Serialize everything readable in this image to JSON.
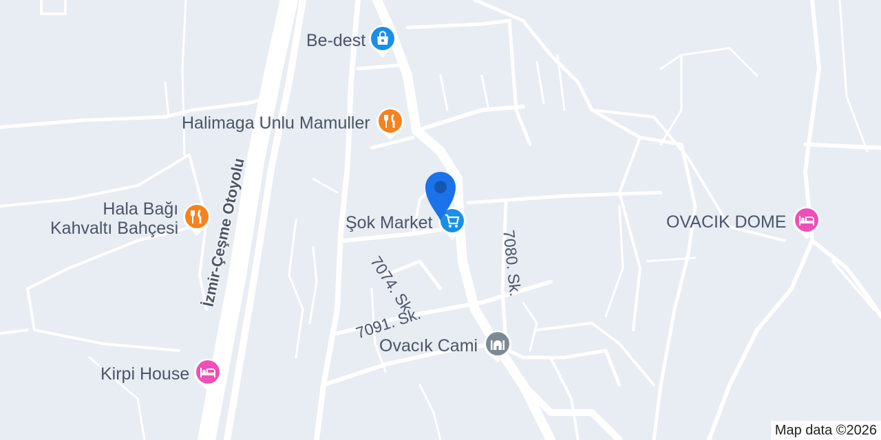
{
  "colors": {
    "background": "#e8ecf3",
    "road": "#ffffff",
    "label_text": "#4b5566",
    "shopping": "#1a8fe8",
    "food": "#f5821f",
    "lodging": "#ef4fb6",
    "worship": "#7d8a96",
    "location_marker": "#1a73e8"
  },
  "pois": [
    {
      "id": "be-dest",
      "label": "Be-dest",
      "category": "shopping",
      "icon": "shopping-bag-icon"
    },
    {
      "id": "halimaga",
      "label": "Halimaga Unlu Mamuller",
      "category": "food",
      "icon": "fork-knife-icon"
    },
    {
      "id": "hala-bagi",
      "label_lines": [
        "Hala Bağı",
        "Kahvaltı Bahçesi"
      ],
      "category": "food",
      "icon": "fork-knife-icon"
    },
    {
      "id": "sok-market",
      "label": "Şok Market",
      "category": "shopping",
      "icon": "shopping-cart-icon"
    },
    {
      "id": "ovacik-dome",
      "label": "OVACIK DOME",
      "category": "lodging",
      "icon": "bed-icon"
    },
    {
      "id": "ovacik-cami",
      "label": "Ovacık Cami",
      "category": "worship",
      "icon": "mosque-icon"
    },
    {
      "id": "kirpi-house",
      "label": "Kirpi House",
      "category": "lodging",
      "icon": "bed-icon"
    }
  ],
  "streets": [
    {
      "id": "otoyol",
      "label": "İzmir-Çeşme Otoyolu"
    },
    {
      "id": "s7074",
      "label": "7074. Sk."
    },
    {
      "id": "s7080",
      "label": "7080. Sk."
    },
    {
      "id": "s7091",
      "label": "7091. Sk."
    }
  ],
  "attribution": "Map data ©2026",
  "location_marker": {
    "icon": "location-pin-icon"
  }
}
